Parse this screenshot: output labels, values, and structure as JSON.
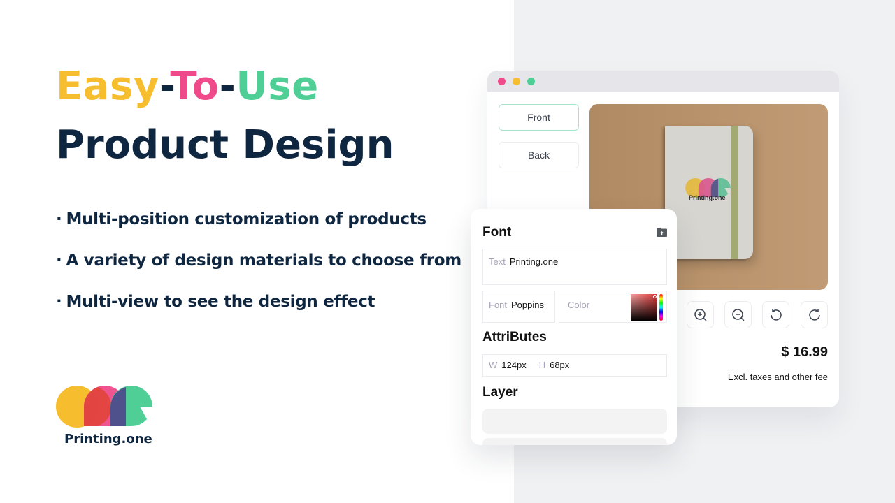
{
  "headline": {
    "word1": "Easy",
    "dash1": "-",
    "word2": "To",
    "dash2": "-",
    "word3": "Use",
    "line2": "Product Design",
    "colors": {
      "easy": "#f6be2f",
      "to": "#ef4b8a",
      "use": "#4fcf95",
      "dark": "#0f2640"
    }
  },
  "features": [
    "Multi-position customization of products",
    "A variety of design materials to choose from",
    "Multi-view to see the design effect"
  ],
  "bullet": "·",
  "brand": {
    "name": "Printing.one",
    "icon": "printing-one-logo"
  },
  "window": {
    "traffic_lights": [
      "close",
      "minimize",
      "maximize"
    ],
    "views": [
      {
        "label": "Front",
        "active": true
      },
      {
        "label": "Back",
        "active": false
      }
    ],
    "preview": {
      "product": "notebook",
      "logo_text": "Printing.one"
    },
    "tools": [
      {
        "icon": "zoom-in-icon"
      },
      {
        "icon": "zoom-out-icon"
      },
      {
        "icon": "rotate-left-icon"
      },
      {
        "icon": "rotate-right-icon"
      }
    ],
    "price": "$ 16.99",
    "price_note": "Excl. taxes and other fee"
  },
  "panel": {
    "font_heading": "Font",
    "upload_icon": "upload-folder-icon",
    "text_label": "Text",
    "text_value": "Printing.one",
    "font_label": "Font",
    "font_value": "Poppins",
    "color_label": "Color",
    "color_value": "#e03a3a",
    "attributes_heading": "AttriButes",
    "width_label": "W",
    "width_value": "124px",
    "height_label": "H",
    "height_value": "68px",
    "layer_heading": "Layer"
  }
}
